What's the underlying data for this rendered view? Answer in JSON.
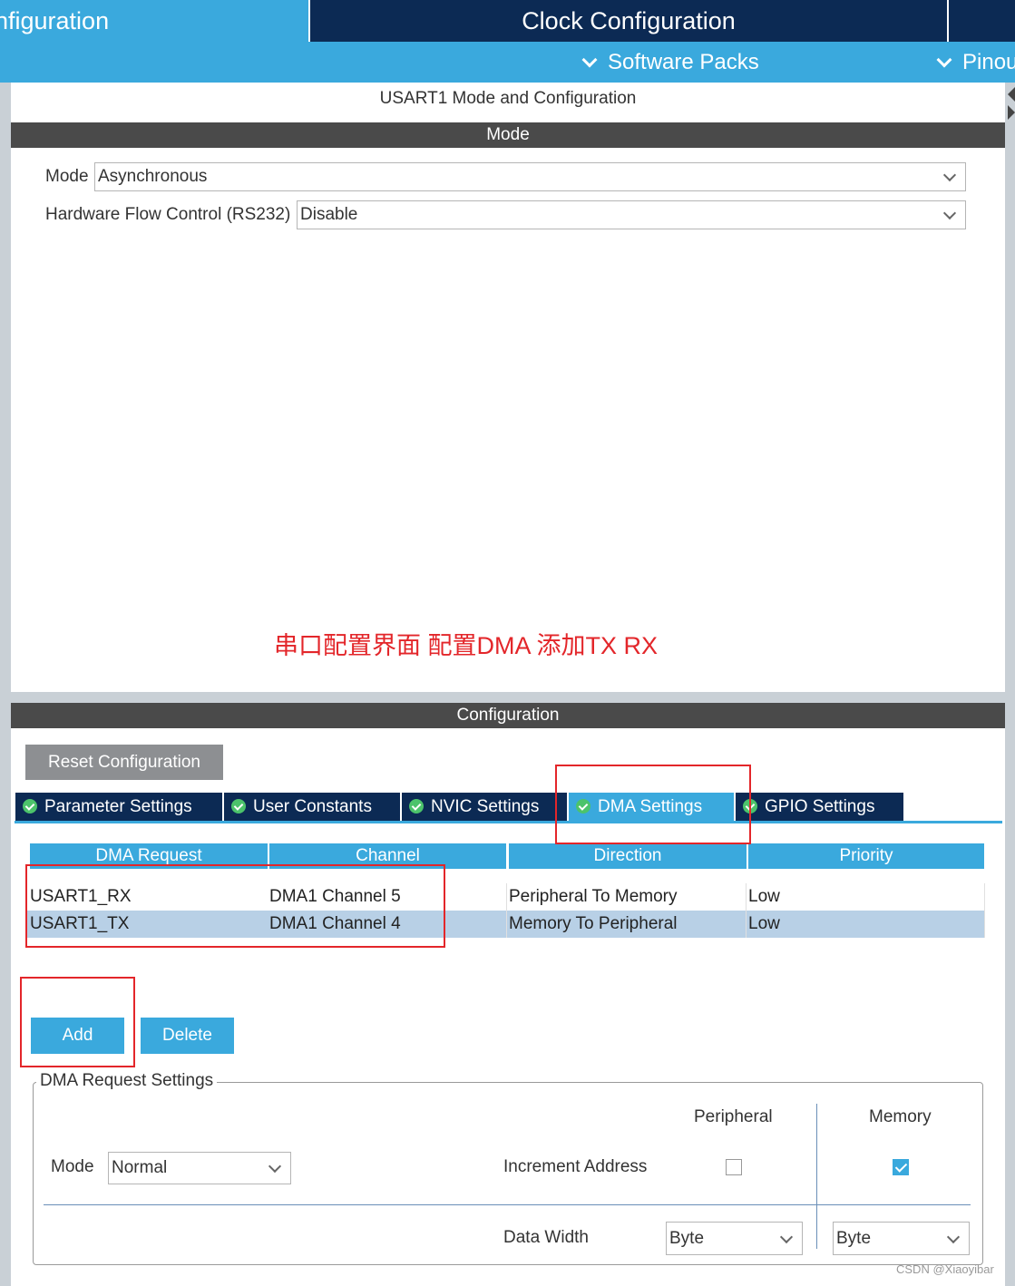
{
  "header": {
    "tab_pinout_config": "nfiguration",
    "tab_clock_config": "Clock Configuration",
    "menu_software_packs": "Software Packs",
    "menu_pinout": "Pinou"
  },
  "mode_panel": {
    "title": "USART1 Mode and Configuration",
    "section_title": "Mode",
    "mode_label": "Mode",
    "mode_value": "Asynchronous",
    "flow_label": "Hardware Flow Control (RS232)",
    "flow_value": "Disable"
  },
  "annotation": "串口配置界面 配置DMA 添加TX RX",
  "config_panel": {
    "section_title": "Configuration",
    "reset_button": "Reset Configuration",
    "tabs": [
      {
        "label": "Parameter Settings",
        "active": false
      },
      {
        "label": "User Constants",
        "active": false
      },
      {
        "label": "NVIC Settings",
        "active": false
      },
      {
        "label": "DMA Settings",
        "active": true
      },
      {
        "label": "GPIO Settings",
        "active": false
      }
    ]
  },
  "dma_table": {
    "columns": [
      "DMA Request",
      "Channel",
      "Direction",
      "Priority"
    ],
    "rows": [
      [
        "USART1_RX",
        "DMA1 Channel 5",
        "Peripheral To Memory",
        "Low"
      ],
      [
        "USART1_TX",
        "DMA1 Channel 4",
        "Memory To Peripheral",
        "Low"
      ]
    ],
    "selected_row": 1
  },
  "actions": {
    "add": "Add",
    "delete": "Delete"
  },
  "dma_request_settings": {
    "legend": "DMA Request Settings",
    "col_peripheral": "Peripheral",
    "col_memory": "Memory",
    "mode_label": "Mode",
    "mode_value": "Normal",
    "increment_label": "Increment Address",
    "increment_peripheral": false,
    "increment_memory": true,
    "data_width_label": "Data Width",
    "data_width_peripheral": "Byte",
    "data_width_memory": "Byte"
  },
  "watermark": "CSDN @Xiaoyibar",
  "colors": {
    "navy": "#0c2a54",
    "accent_blue": "#3aa9dd",
    "section_gray": "#4a4a4a",
    "annotation_red": "#e3262a",
    "selected_row": "#b8d0e6"
  }
}
